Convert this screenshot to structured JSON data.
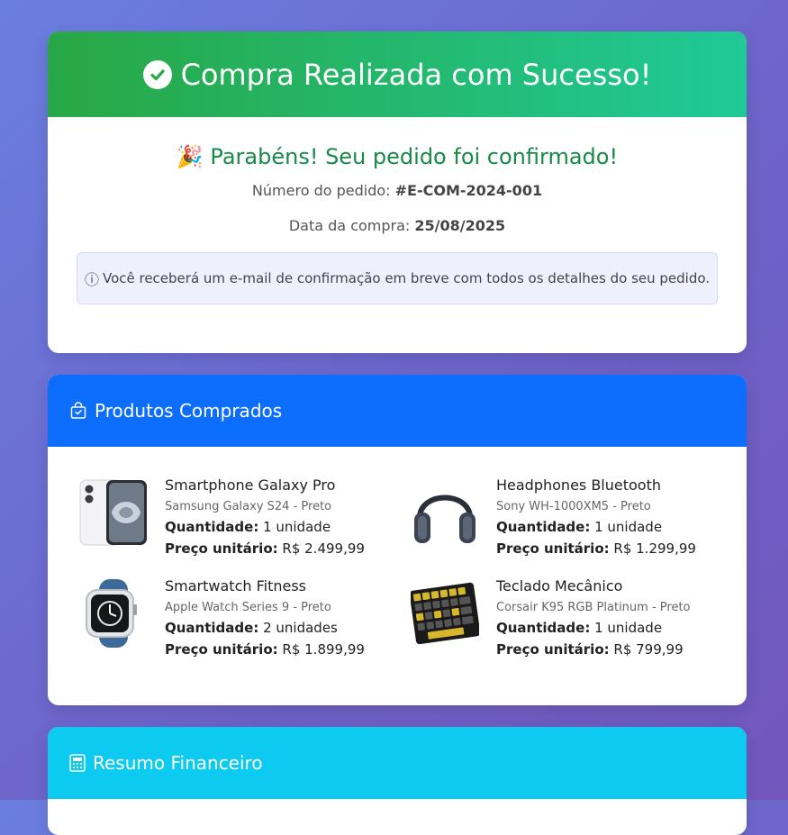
{
  "success": {
    "title": "Compra Realizada com Sucesso!",
    "congrats": "🎉 Parabéns! Seu pedido foi confirmado!",
    "order_label": "Número do pedido:",
    "order_number": "#E-COM-2024-001",
    "date_label": "Data da compra:",
    "date_value": "25/08/2025",
    "info_text": "Você receberá um e-mail de confirmação em breve com todos os detalhes do seu pedido.",
    "info_icon": "ⓘ"
  },
  "products": {
    "title": "Produtos Comprados",
    "qty_label": "Quantidade:",
    "price_label": "Preço unitário:",
    "items": [
      {
        "name": "Smartphone Galaxy Pro",
        "sub": "Samsung Galaxy S24 - Preto",
        "qty": "1 unidade",
        "price": "R$ 2.499,99",
        "icon": "smartphone-image"
      },
      {
        "name": "Headphones Bluetooth",
        "sub": "Sony WH-1000XM5 - Preto",
        "qty": "1 unidade",
        "price": "R$ 1.299,99",
        "icon": "headphones-image"
      },
      {
        "name": "Smartwatch Fitness",
        "sub": "Apple Watch Series 9 - Preto",
        "qty": "2 unidades",
        "price": "R$ 1.899,99",
        "icon": "smartwatch-image"
      },
      {
        "name": "Teclado Mecânico",
        "sub": "Corsair K95 RGB Platinum - Preto",
        "qty": "1 unidade",
        "price": "R$ 799,99",
        "icon": "keyboard-image"
      }
    ]
  },
  "summary": {
    "title": "Resumo Financeiro"
  },
  "colors": {
    "success_start": "#28a745",
    "success_end": "#20c997",
    "products_header": "#0d6efd",
    "summary_header": "#0dcaf0"
  }
}
